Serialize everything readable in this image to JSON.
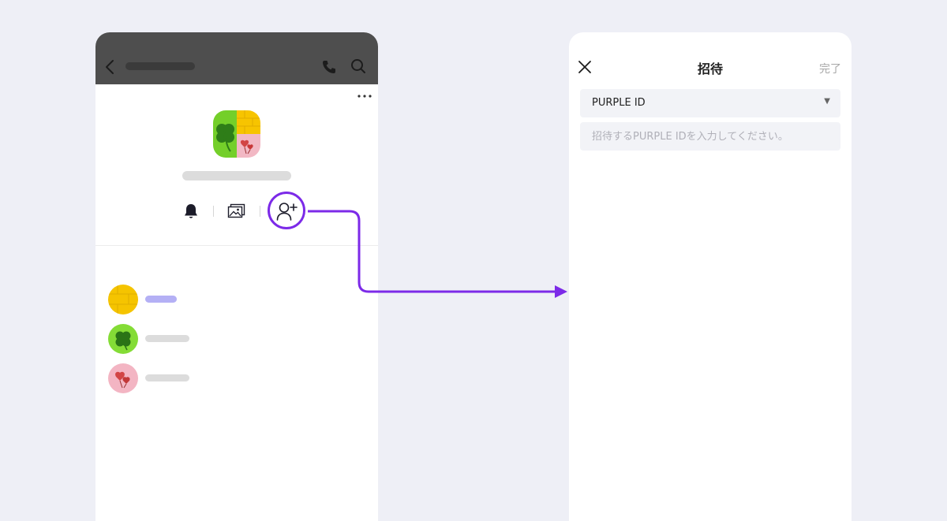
{
  "chat": {
    "header_icons": [
      "back-arrow-icon",
      "phone-icon",
      "search-icon"
    ],
    "more_icon": "more-dots-icon",
    "actions": [
      {
        "id": "notifications",
        "icon": "bell-icon"
      },
      {
        "id": "album",
        "icon": "image-icon"
      },
      {
        "id": "invite",
        "icon": "add-person-icon",
        "highlighted": true
      }
    ],
    "members": [
      {
        "avatar": "yellow-avatar",
        "bar_color": "#b4b0f5"
      },
      {
        "avatar": "clover-avatar",
        "bar_color": "#dcdcdc"
      },
      {
        "avatar": "heart-avatar",
        "bar_color": "#dcdcdc"
      }
    ]
  },
  "colors": {
    "accent": "#7c2ae8",
    "chat_header": "#4e4e4e",
    "background": "#eeeff6",
    "field": "#f2f3f7"
  },
  "invite": {
    "title": "招待",
    "done_label": "完了",
    "id_type": {
      "selected": "PURPLE ID"
    },
    "id_input": {
      "value": "",
      "placeholder": "招待するPURPLE IDを入力してください。"
    }
  }
}
